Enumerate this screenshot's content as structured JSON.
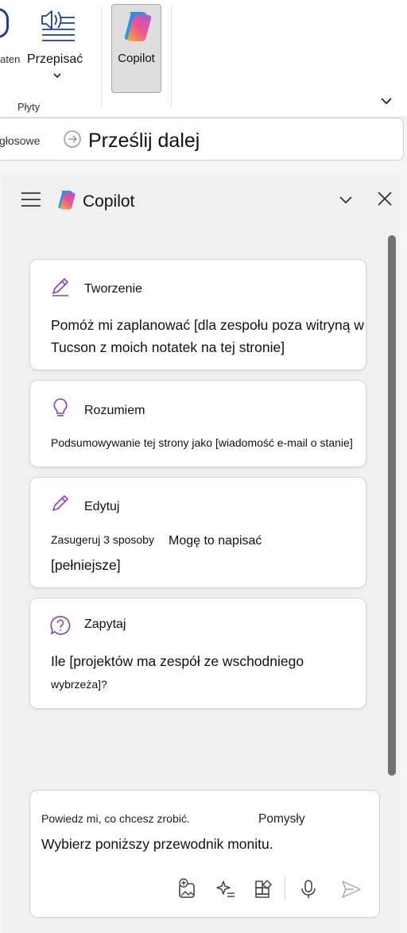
{
  "ribbon": {
    "partial_label": "aten",
    "przepisac_label": "Przepisać",
    "group_label": "Płyty",
    "copilot_label": "Copilot"
  },
  "sendbar": {
    "label_left": "głosowe",
    "label_main": "Prześlij dalej"
  },
  "pane": {
    "title": "Copilot",
    "cards": [
      {
        "title": "Tworzenie",
        "text": "Pomóż mi zaplanować [dla zespołu poza witryną w Tucson z moich notatek na tej stronie]",
        "icon": "pen-sparkle-icon"
      },
      {
        "title": "Rozumiem",
        "text": "Podsumowywanie tej strony jako [wiadomość e-mail o stanie]",
        "icon": "lightbulb-icon"
      },
      {
        "title": "Edytuj",
        "text_small": "Zasugeruj 3 sposoby",
        "text_mid": "Mogę to napisać",
        "text_line2": "[pełniejsze]",
        "icon": "pencil-icon"
      },
      {
        "title": "Zapytaj",
        "text": "Ile [projektów ma zespół ze wschodniego",
        "text_line2": "wybrzeża]?",
        "icon": "question-bubble-icon"
      }
    ],
    "composer": {
      "hint": "Powiedz mi, co chcesz zrobić.",
      "ideas": "Pomysły",
      "prompt": "Wybierz poniższy przewodnik monitu."
    }
  },
  "colors": {
    "accent_purple": "#8a3fb5",
    "ribbon_blue": "#1f3f8f"
  }
}
